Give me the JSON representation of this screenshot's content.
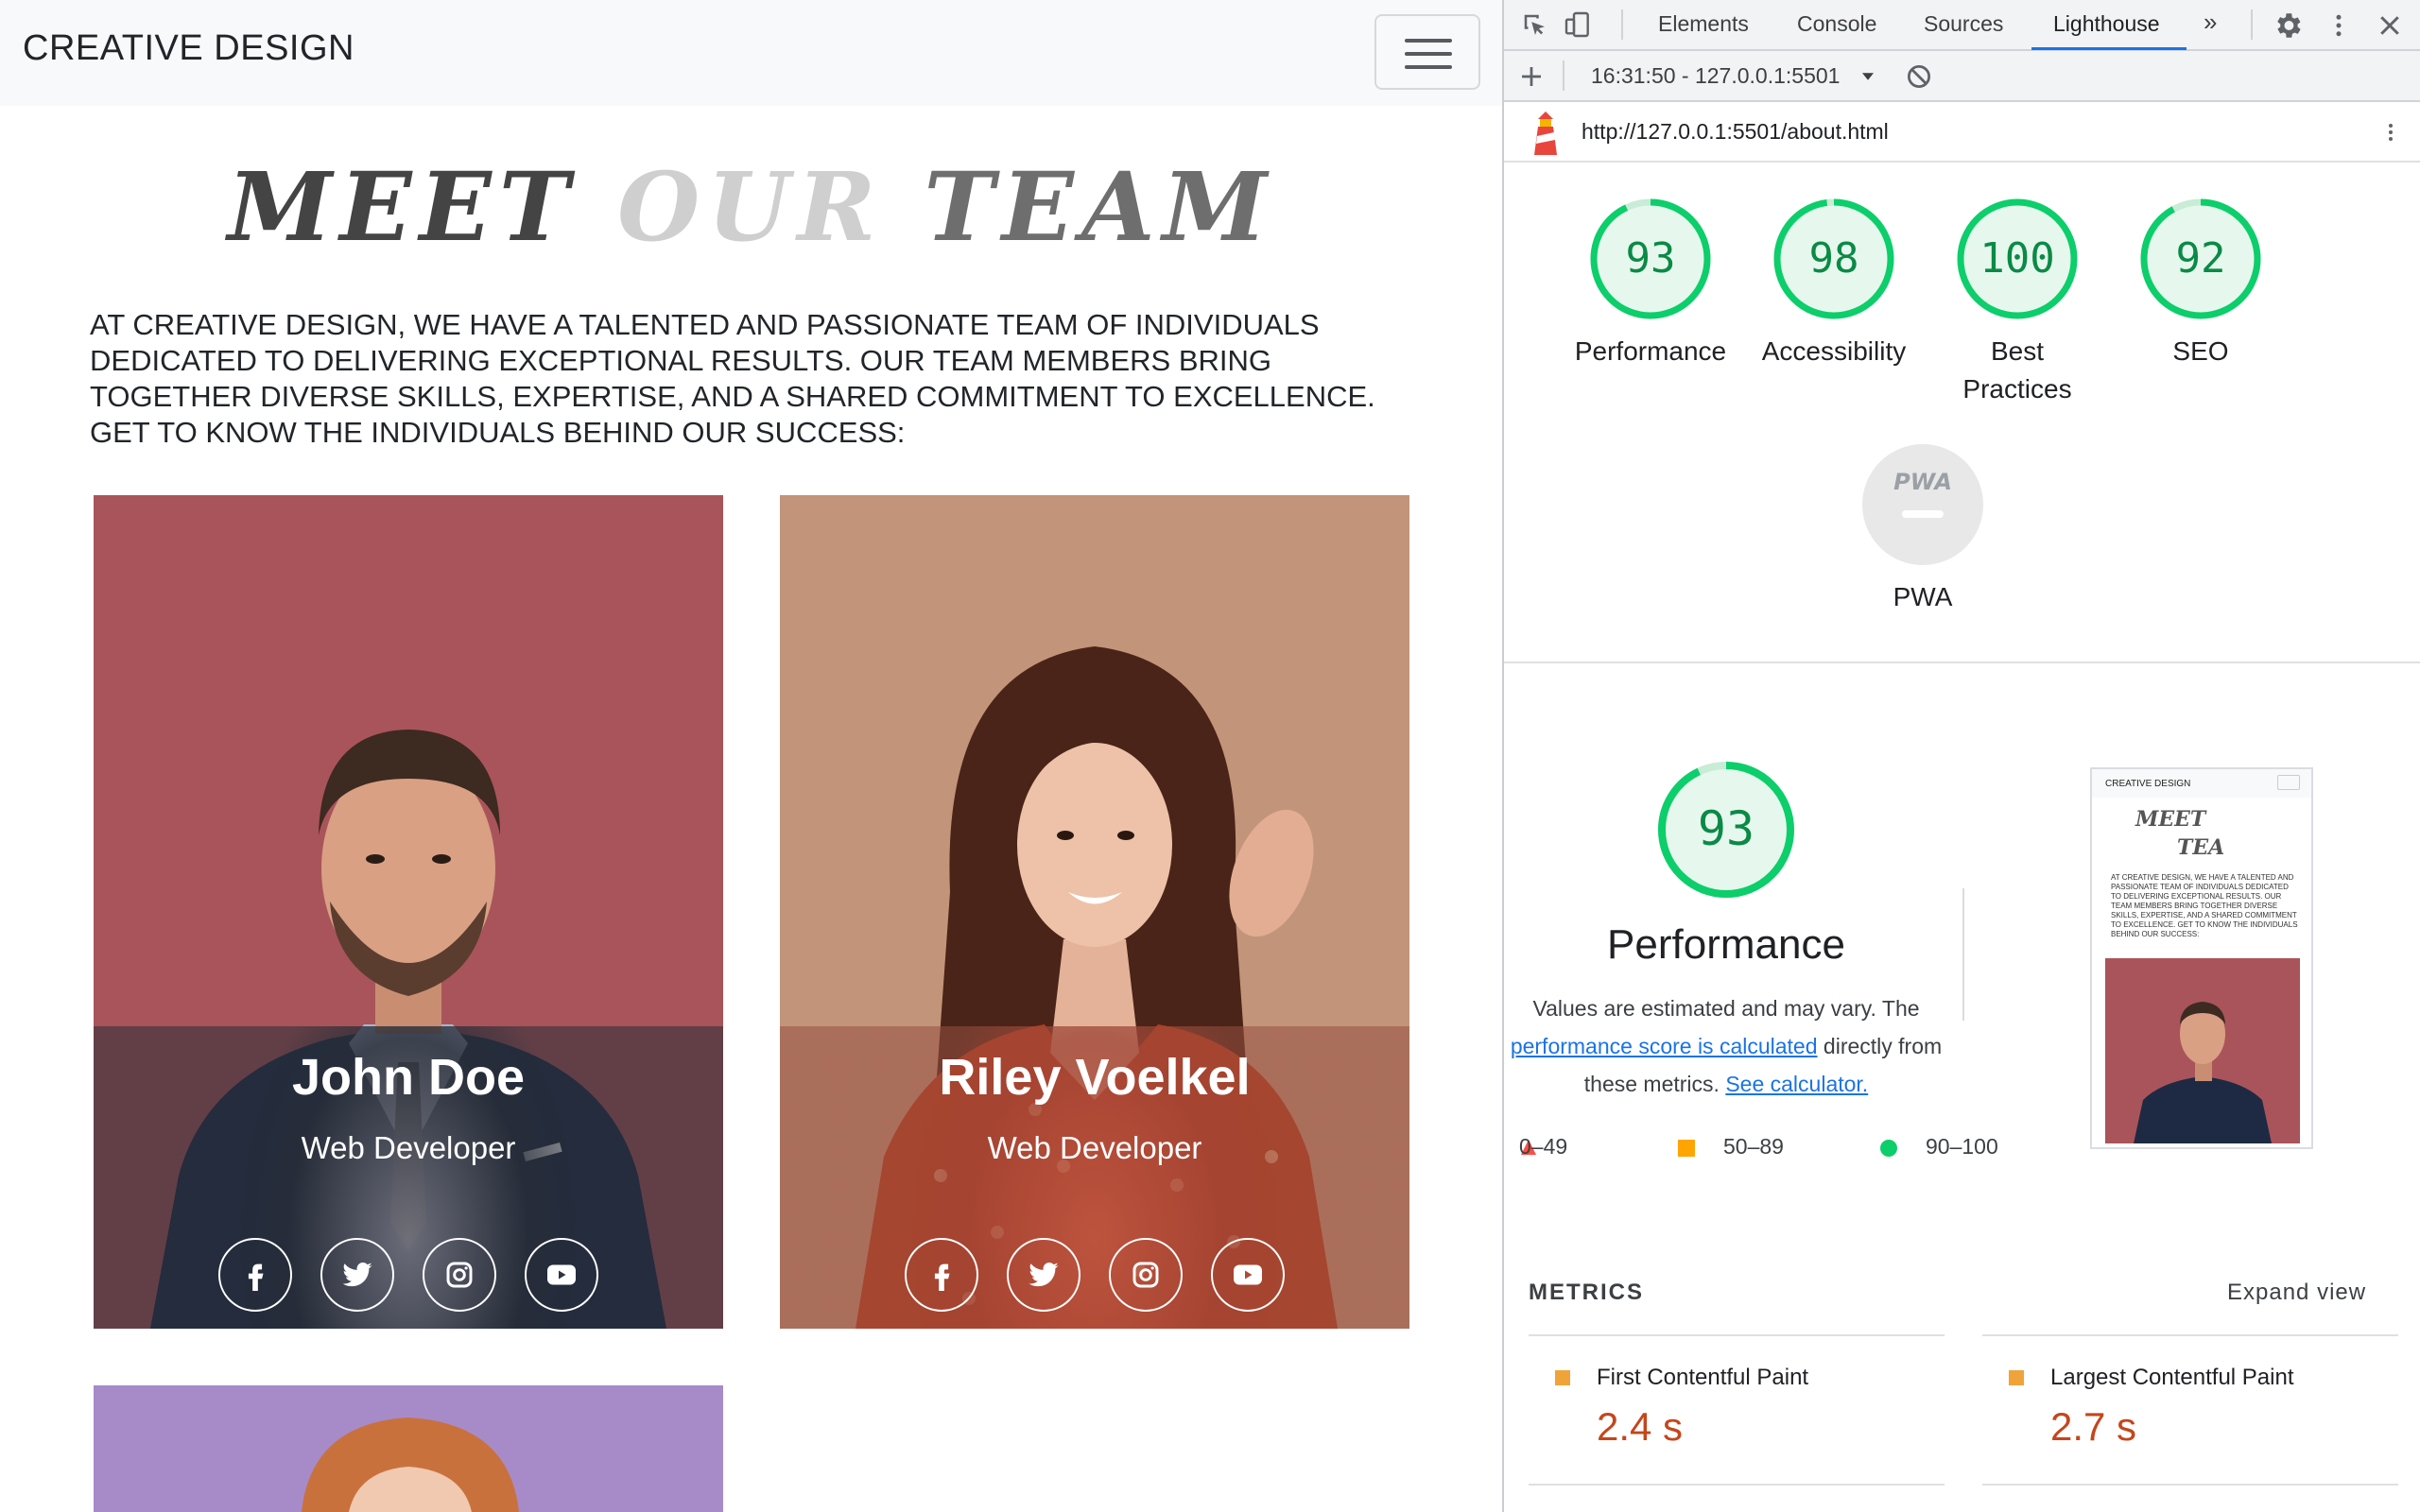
{
  "site": {
    "brand": "CREATIVE DESIGN",
    "title_words": [
      "MEET",
      "OUR",
      "TEAM"
    ],
    "intro": "AT CREATIVE DESIGN, WE HAVE A TALENTED AND PASSIONATE TEAM OF INDIVIDUALS DEDICATED TO DELIVERING EXCEPTIONAL RESULTS. OUR TEAM MEMBERS BRING TOGETHER DIVERSE SKILLS, EXPERTISE, AND A SHARED COMMITMENT TO EXCELLENCE. GET TO KNOW THE INDIVIDUALS BEHIND OUR SUCCESS:",
    "members": [
      {
        "name": "John Doe",
        "role": "Web Developer"
      },
      {
        "name": "Riley Voelkel",
        "role": "Web Developer"
      }
    ],
    "social_icons": [
      "facebook-icon",
      "twitter-icon",
      "instagram-icon",
      "youtube-icon"
    ]
  },
  "devtools": {
    "tabs": [
      "Elements",
      "Console",
      "Sources",
      "Lighthouse"
    ],
    "active_tab": "Lighthouse",
    "more_tabs": "»",
    "report_selector": "16:31:50 - 127.0.0.1:5501",
    "url": "http://127.0.0.1:5501/about.html",
    "scores": [
      {
        "value": "93",
        "label": "Performance"
      },
      {
        "value": "98",
        "label": "Accessibility"
      },
      {
        "value": "100",
        "label": "Best Practices"
      },
      {
        "value": "92",
        "label": "SEO"
      }
    ],
    "pwa": {
      "badge": "PWA",
      "label": "PWA"
    },
    "perf_section": {
      "score": "93",
      "title": "Performance",
      "desc_1": "Values are estimated and may vary. The",
      "desc_link": "performance score is calculated",
      "desc_2": "directly from",
      "desc_3": "these metrics.",
      "calc_link": "See calculator."
    },
    "legend": [
      "0–49",
      "50–89",
      "90–100"
    ],
    "thumbnail": {
      "brand": "CREATIVE DESIGN",
      "title_1": "MEET",
      "title_2": "TEA",
      "intro": "AT CREATIVE DESIGN, WE HAVE A TALENTED AND PASSIONATE TEAM OF INDIVIDUALS DEDICATED TO DELIVERING EXCEPTIONAL RESULTS. OUR TEAM MEMBERS BRING TOGETHER DIVERSE SKILLS, EXPERTISE, AND A SHARED COMMITMENT TO EXCELLENCE. GET TO KNOW THE INDIVIDUALS BEHIND OUR SUCCESS:"
    },
    "metrics": {
      "heading": "METRICS",
      "expand": "Expand view",
      "items": [
        {
          "label": "First Contentful Paint",
          "value": "2.4 s"
        },
        {
          "label": "Largest Contentful Paint",
          "value": "2.7 s"
        }
      ]
    },
    "colors": {
      "pass": "#0cce6b",
      "average": "#ffa400",
      "fail": "#ff4e42",
      "link": "#1a73e8"
    }
  }
}
